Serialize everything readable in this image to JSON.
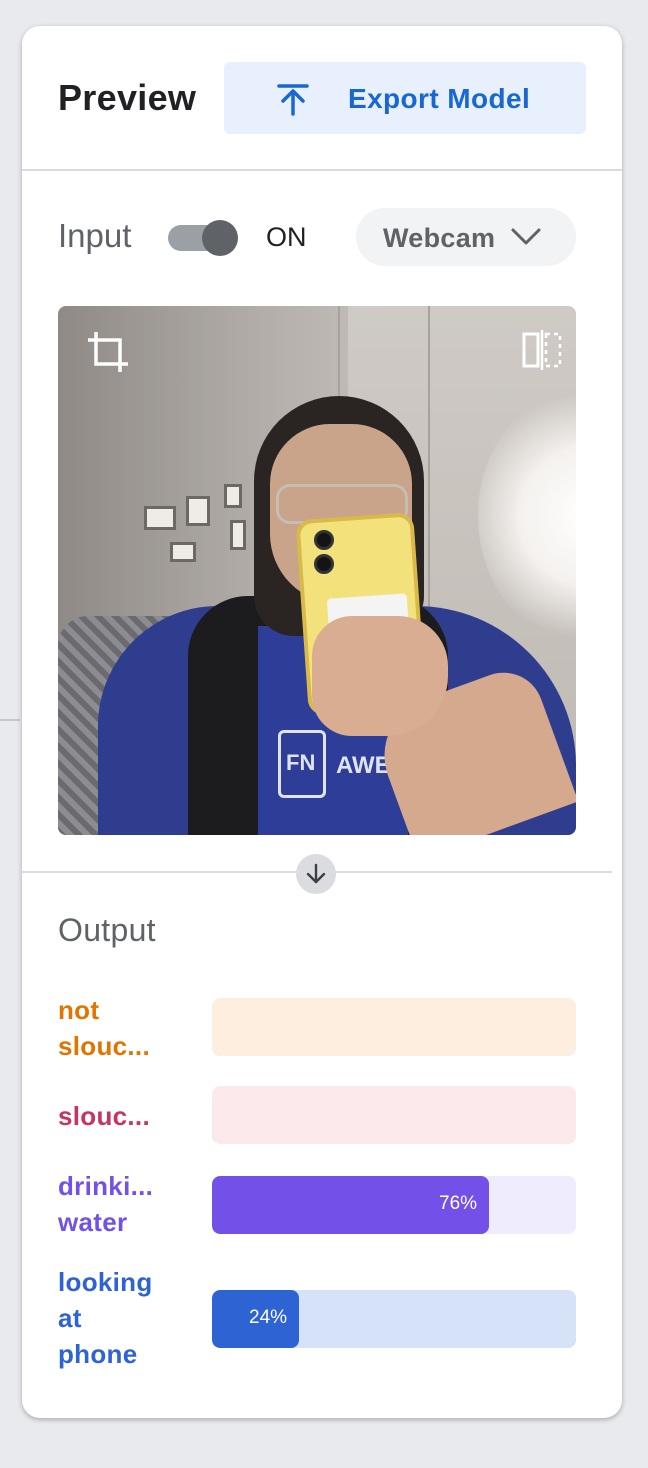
{
  "header": {
    "title": "Preview",
    "export_label": "Export Model"
  },
  "input": {
    "label": "Input",
    "toggle_state": "ON",
    "toggle_on": true,
    "source_label": "Webcam"
  },
  "output": {
    "title": "Output",
    "classes": [
      {
        "name_lines": [
          "not",
          "slouc..."
        ],
        "percent": 0,
        "percent_label": "",
        "color": "#e37400",
        "track": "#fdeee0"
      },
      {
        "name_lines": [
          "slouc..."
        ],
        "percent": 0,
        "percent_label": "",
        "color": "#c5355f",
        "track": "#fbe9eb"
      },
      {
        "name_lines": [
          "drinki...",
          "water"
        ],
        "percent": 76,
        "percent_label": "76%",
        "color": "#7350e8",
        "track": "#efecfd"
      },
      {
        "name_lines": [
          "looking",
          "at",
          "phone"
        ],
        "percent": 24,
        "percent_label": "24%",
        "color": "#2d63d2",
        "track": "#d5e2f8"
      }
    ]
  },
  "icons": {
    "export": "upload-arrow-icon",
    "dropdown": "chevron-down-icon",
    "crop": "crop-icon",
    "flip": "flip-horizontal-icon",
    "arrow": "arrow-down-icon"
  }
}
